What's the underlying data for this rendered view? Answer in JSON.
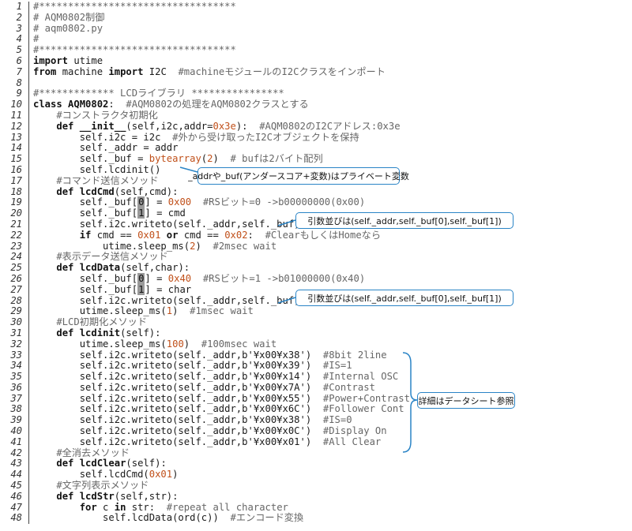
{
  "code_lines": [
    {
      "n": "1",
      "segs": [
        {
          "t": "#**********************************",
          "c": "cm"
        }
      ]
    },
    {
      "n": "2",
      "segs": [
        {
          "t": "# AQM0802制御",
          "c": "cm"
        }
      ]
    },
    {
      "n": "3",
      "segs": [
        {
          "t": "# aqm0802.py",
          "c": "cm"
        }
      ]
    },
    {
      "n": "4",
      "segs": [
        {
          "t": "#",
          "c": "cm"
        }
      ]
    },
    {
      "n": "5",
      "segs": [
        {
          "t": "#**********************************",
          "c": "cm"
        }
      ]
    },
    {
      "n": "6",
      "segs": [
        {
          "t": "import",
          "c": "kw"
        },
        {
          "t": " utime"
        }
      ]
    },
    {
      "n": "7",
      "segs": [
        {
          "t": "from",
          "c": "kw"
        },
        {
          "t": " machine "
        },
        {
          "t": "import",
          "c": "kw"
        },
        {
          "t": " I2C  "
        },
        {
          "t": "#machineモジュールのI2Cクラスをインポート",
          "c": "cm"
        }
      ]
    },
    {
      "n": "8",
      "segs": [
        {
          "t": ""
        }
      ]
    },
    {
      "n": "9",
      "segs": [
        {
          "t": "#************* LCDライブラリ ****************",
          "c": "cm"
        }
      ]
    },
    {
      "n": "10",
      "segs": [
        {
          "t": "class",
          "c": "kw"
        },
        {
          "t": " "
        },
        {
          "t": "AQM0802",
          "c": "kw"
        },
        {
          "t": ":  "
        },
        {
          "t": "#AQM0802の処理をAQM0802クラスとする",
          "c": "cm"
        }
      ]
    },
    {
      "n": "11",
      "segs": [
        {
          "t": "    #コンストラクタ初期化",
          "c": "cm"
        }
      ]
    },
    {
      "n": "12",
      "segs": [
        {
          "t": "    "
        },
        {
          "t": "def",
          "c": "kw"
        },
        {
          "t": " "
        },
        {
          "t": "__init__",
          "c": "kw"
        },
        {
          "t": "(self,i2c,addr="
        },
        {
          "t": "0x3e",
          "c": "nm"
        },
        {
          "t": "):  "
        },
        {
          "t": "#AQM0802のI2Cアドレス:0x3e",
          "c": "cm"
        }
      ]
    },
    {
      "n": "13",
      "segs": [
        {
          "t": "        self.i2c = i2c  "
        },
        {
          "t": "#外から受け取ったI2Cオブジェクトを保持",
          "c": "cm"
        }
      ]
    },
    {
      "n": "14",
      "segs": [
        {
          "t": "        self._addr = addr"
        }
      ]
    },
    {
      "n": "15",
      "segs": [
        {
          "t": "        self._buf = "
        },
        {
          "t": "bytearray",
          "c": "nm"
        },
        {
          "t": "("
        },
        {
          "t": "2",
          "c": "nm"
        },
        {
          "t": ")  "
        },
        {
          "t": "# bufは2バイト配列",
          "c": "cm"
        }
      ]
    },
    {
      "n": "16",
      "segs": [
        {
          "t": "        self.lcdinit()"
        }
      ]
    },
    {
      "n": "17",
      "segs": [
        {
          "t": "    #コマンド送信メソッド",
          "c": "cm"
        }
      ]
    },
    {
      "n": "18",
      "segs": [
        {
          "t": "    "
        },
        {
          "t": "def",
          "c": "kw"
        },
        {
          "t": " "
        },
        {
          "t": "lcdCmd",
          "c": "kw"
        },
        {
          "t": "(self,cmd):"
        }
      ]
    },
    {
      "n": "19",
      "segs": [
        {
          "t": "        self._buf["
        },
        {
          "t": "0",
          "c": "hl"
        },
        {
          "t": "] = "
        },
        {
          "t": "0x00",
          "c": "nm"
        },
        {
          "t": "  "
        },
        {
          "t": "#RSビット=0 ->b00000000(0x00)",
          "c": "cm"
        }
      ]
    },
    {
      "n": "20",
      "segs": [
        {
          "t": "        self._buf["
        },
        {
          "t": "1",
          "c": "hl"
        },
        {
          "t": "] = cmd"
        }
      ]
    },
    {
      "n": "21",
      "segs": [
        {
          "t": "        self.i2c.writeto(self._addr,self._buf)"
        }
      ]
    },
    {
      "n": "22",
      "segs": [
        {
          "t": "        "
        },
        {
          "t": "if",
          "c": "kw"
        },
        {
          "t": " cmd == "
        },
        {
          "t": "0x01",
          "c": "nm"
        },
        {
          "t": " "
        },
        {
          "t": "or",
          "c": "kw"
        },
        {
          "t": " cmd == "
        },
        {
          "t": "0x02",
          "c": "nm"
        },
        {
          "t": ":  "
        },
        {
          "t": "#ClearもしくはHomeなら",
          "c": "cm"
        }
      ]
    },
    {
      "n": "23",
      "segs": [
        {
          "t": "            utime.sleep_ms("
        },
        {
          "t": "2",
          "c": "nm"
        },
        {
          "t": ")  "
        },
        {
          "t": "#2msec wait",
          "c": "cm"
        }
      ]
    },
    {
      "n": "24",
      "segs": [
        {
          "t": "    #表示データ送信メソッド",
          "c": "cm"
        }
      ]
    },
    {
      "n": "25",
      "segs": [
        {
          "t": "    "
        },
        {
          "t": "def",
          "c": "kw"
        },
        {
          "t": " "
        },
        {
          "t": "lcdData",
          "c": "kw"
        },
        {
          "t": "(self,char):"
        }
      ]
    },
    {
      "n": "26",
      "segs": [
        {
          "t": "        self._buf["
        },
        {
          "t": "0",
          "c": "hl"
        },
        {
          "t": "] = "
        },
        {
          "t": "0x40",
          "c": "nm"
        },
        {
          "t": "  "
        },
        {
          "t": "#RSビット=1 ->b01000000(0x40)",
          "c": "cm"
        }
      ]
    },
    {
      "n": "27",
      "segs": [
        {
          "t": "        self._buf["
        },
        {
          "t": "1",
          "c": "hl"
        },
        {
          "t": "] = char"
        }
      ]
    },
    {
      "n": "28",
      "segs": [
        {
          "t": "        self.i2c.writeto(self._addr,self._buf)"
        }
      ]
    },
    {
      "n": "29",
      "segs": [
        {
          "t": "        utime.sleep_ms("
        },
        {
          "t": "1",
          "c": "nm"
        },
        {
          "t": ")  "
        },
        {
          "t": "#1msec wait",
          "c": "cm"
        }
      ]
    },
    {
      "n": "30",
      "segs": [
        {
          "t": "    #LCD初期化メソッド",
          "c": "cm"
        }
      ]
    },
    {
      "n": "31",
      "segs": [
        {
          "t": "    "
        },
        {
          "t": "def",
          "c": "kw"
        },
        {
          "t": " "
        },
        {
          "t": "lcdinit",
          "c": "kw"
        },
        {
          "t": "(self):"
        }
      ]
    },
    {
      "n": "32",
      "segs": [
        {
          "t": "        utime.sleep_ms("
        },
        {
          "t": "100",
          "c": "nm"
        },
        {
          "t": ")  "
        },
        {
          "t": "#100msec wait",
          "c": "cm"
        }
      ]
    },
    {
      "n": "33",
      "segs": [
        {
          "t": "        self.i2c.writeto(self._addr,b'¥x00¥x38')  "
        },
        {
          "t": "#8bit 2line",
          "c": "cm"
        }
      ]
    },
    {
      "n": "34",
      "segs": [
        {
          "t": "        self.i2c.writeto(self._addr,b'¥x00¥x39')  "
        },
        {
          "t": "#IS=1",
          "c": "cm"
        }
      ]
    },
    {
      "n": "35",
      "segs": [
        {
          "t": "        self.i2c.writeto(self._addr,b'¥x00¥x14')  "
        },
        {
          "t": "#Internal OSC",
          "c": "cm"
        }
      ]
    },
    {
      "n": "36",
      "segs": [
        {
          "t": "        self.i2c.writeto(self._addr,b'¥x00¥x7A')  "
        },
        {
          "t": "#Contrast",
          "c": "cm"
        }
      ]
    },
    {
      "n": "37",
      "segs": [
        {
          "t": "        self.i2c.writeto(self._addr,b'¥x00¥x55')  "
        },
        {
          "t": "#Power+Contrast",
          "c": "cm"
        }
      ]
    },
    {
      "n": "38",
      "segs": [
        {
          "t": "        self.i2c.writeto(self._addr,b'¥x00¥x6C')  "
        },
        {
          "t": "#Follower Cont",
          "c": "cm"
        }
      ]
    },
    {
      "n": "39",
      "segs": [
        {
          "t": "        self.i2c.writeto(self._addr,b'¥x00¥x38')  "
        },
        {
          "t": "#IS=0",
          "c": "cm"
        }
      ]
    },
    {
      "n": "40",
      "segs": [
        {
          "t": "        self.i2c.writeto(self._addr,b'¥x00¥x0C')  "
        },
        {
          "t": "#Display On",
          "c": "cm"
        }
      ]
    },
    {
      "n": "41",
      "segs": [
        {
          "t": "        self.i2c.writeto(self._addr,b'¥x00¥x01')  "
        },
        {
          "t": "#All Clear",
          "c": "cm"
        }
      ]
    },
    {
      "n": "42",
      "segs": [
        {
          "t": "    #全消去メソッド",
          "c": "cm"
        }
      ]
    },
    {
      "n": "43",
      "segs": [
        {
          "t": "    "
        },
        {
          "t": "def",
          "c": "kw"
        },
        {
          "t": " "
        },
        {
          "t": "lcdClear",
          "c": "kw"
        },
        {
          "t": "(self):"
        }
      ]
    },
    {
      "n": "44",
      "segs": [
        {
          "t": "        self.lcdCmd("
        },
        {
          "t": "0x01",
          "c": "nm"
        },
        {
          "t": ")"
        }
      ]
    },
    {
      "n": "45",
      "segs": [
        {
          "t": "    #文字列表示メソッド",
          "c": "cm"
        }
      ]
    },
    {
      "n": "46",
      "segs": [
        {
          "t": "    "
        },
        {
          "t": "def",
          "c": "kw"
        },
        {
          "t": " "
        },
        {
          "t": "lcdStr",
          "c": "kw"
        },
        {
          "t": "(self,str):"
        }
      ]
    },
    {
      "n": "47",
      "segs": [
        {
          "t": "        "
        },
        {
          "t": "for",
          "c": "kw"
        },
        {
          "t": " c "
        },
        {
          "t": "in",
          "c": "kw"
        },
        {
          "t": " str:  "
        },
        {
          "t": "#repeat all character",
          "c": "cm"
        }
      ]
    },
    {
      "n": "48",
      "segs": [
        {
          "t": "            self.lcdData(ord(c))  "
        },
        {
          "t": "#エンコード変換",
          "c": "cm"
        }
      ]
    }
  ],
  "callouts": {
    "private_vars": "_addrや_buf(アンダースコア+変数)はプライベート変数",
    "args_order_cmd": "引数並びは(self._addr,self._buf[0],self._buf[1])",
    "args_order_data": "引数並びは(self._addr,self._buf[0],self._buf[1])",
    "datasheet": "詳細はデータシート参照"
  },
  "colors": {
    "callout_border": "#2a84c6",
    "number": "#c0501a",
    "comment": "#666666"
  }
}
